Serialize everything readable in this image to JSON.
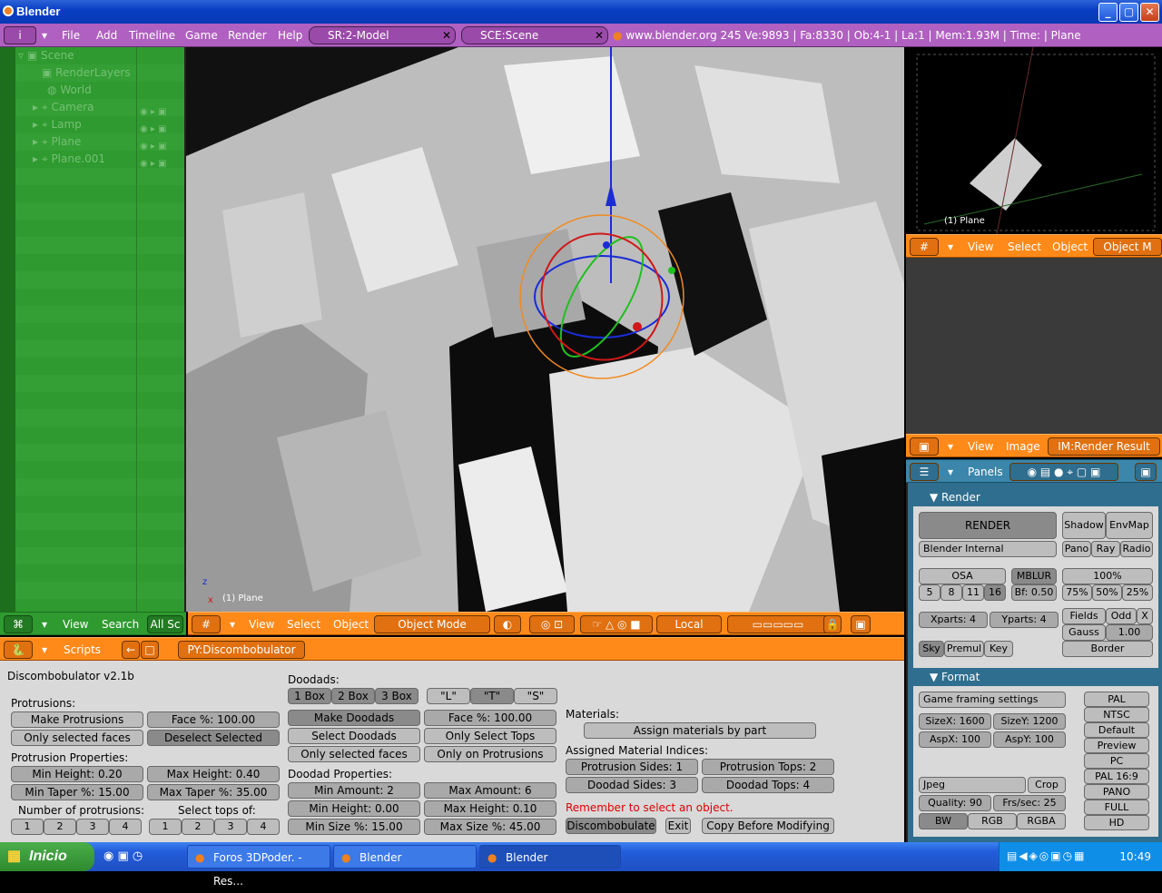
{
  "window": {
    "title": "Blender",
    "min": "_",
    "max": "▢",
    "close": "✕"
  },
  "menubar": {
    "menus": [
      "File",
      "Add",
      "Timeline",
      "Game",
      "Render",
      "Help"
    ],
    "screen": "SR:2-Model",
    "scene": "SCE:Scene",
    "site": "www.blender.org 245",
    "stats": "Ve:9893 | Fa:8330 | Ob:4-1 | La:1 | Mem:1.93M | Time: | Plane"
  },
  "outliner": {
    "items": [
      {
        "label": "Scene",
        "indent": 0
      },
      {
        "label": "RenderLayers",
        "indent": 1
      },
      {
        "label": "World",
        "indent": 1
      },
      {
        "label": "Camera",
        "indent": 1
      },
      {
        "label": "Lamp",
        "indent": 1
      },
      {
        "label": "Plane",
        "indent": 1
      },
      {
        "label": "Plane.001",
        "indent": 1
      }
    ],
    "header": {
      "view": "View",
      "search": "Search",
      "filter": "All Sc"
    }
  },
  "viewport": {
    "label": "(1) Plane",
    "header": {
      "view": "View",
      "select": "Select",
      "object": "Object",
      "mode": "Object Mode",
      "orientation": "Local"
    }
  },
  "preview": {
    "label": "(1) Plane",
    "header": {
      "view": "View",
      "select": "Select",
      "object": "Object",
      "mode": "Object M"
    }
  },
  "imageview": {
    "header": {
      "view": "View",
      "image": "Image",
      "name": "IM:Render Result"
    }
  },
  "buttons": {
    "header": {
      "panels": "Panels"
    },
    "render_panel": {
      "title": "Render",
      "render": "RENDER",
      "engine": "Blender Internal",
      "shadow": "Shadow",
      "envmap": "EnvMap",
      "pano": "Pano",
      "ray": "Ray",
      "radio": "Radio",
      "osa": "OSA",
      "osa_values": [
        "5",
        "8",
        "11",
        "16"
      ],
      "mblur": "MBLUR",
      "bf": "Bf: 0.50",
      "percent": "100%",
      "percents": [
        "75%",
        "50%",
        "25%"
      ],
      "xparts": "Xparts: 4",
      "yparts": "Yparts: 4",
      "fields": "Fields",
      "odd": "Odd",
      "x": "X",
      "gauss": "Gauss",
      "gauss_val": "1.00",
      "sky": "Sky",
      "premul": "Premul",
      "key": "Key",
      "border": "Border"
    },
    "format_panel": {
      "title": "Format",
      "preset": "Game framing settings",
      "sizex": "SizeX: 1600",
      "sizey": "SizeY: 1200",
      "aspx": "AspX: 100",
      "aspy": "AspY: 100",
      "presets": [
        "PAL",
        "NTSC",
        "Default",
        "Preview",
        "PC",
        "PAL 16:9",
        "PANO",
        "FULL",
        "HD"
      ],
      "filetype": "Jpeg",
      "crop": "Crop",
      "quality": "Quality: 90",
      "fps": "Frs/sec: 25",
      "bw": "BW",
      "rgb": "RGB",
      "rgba": "RGBA"
    }
  },
  "scripts": {
    "header": {
      "title": "Scripts",
      "script": "PY:Discombobulator"
    },
    "version": "Discombobulator v2.1b",
    "protrusions": {
      "heading": "Protrusions:",
      "make": "Make Protrusions",
      "face": "Face %: 100.00",
      "only_selected": "Only selected faces",
      "deselect": "Deselect Selected",
      "props_heading": "Protrusion Properties:",
      "min_height": "Min Height: 0.20",
      "max_height": "Max Height: 0.40",
      "min_taper": "Min Taper %: 15.00",
      "max_taper": "Max Taper %: 35.00",
      "number_heading": "Number of protrusions:",
      "tops_heading": "Select tops of:",
      "numbers": [
        "1",
        "2",
        "3",
        "4"
      ],
      "tops": [
        "1",
        "2",
        "3",
        "4"
      ]
    },
    "doodads": {
      "heading": "Doodads:",
      "boxes": [
        "1 Box",
        "2 Box",
        "3 Box"
      ],
      "shapes": [
        "\"L\"",
        "\"T\"",
        "\"S\""
      ],
      "make": "Make Doodads",
      "face": "Face %: 100.00",
      "select": "Select Doodads",
      "only_tops": "Only Select Tops",
      "only_selected": "Only selected faces",
      "only_protrusions": "Only on Protrusions",
      "props_heading": "Doodad Properties:",
      "min_amount": "Min Amount: 2",
      "max_amount": "Max Amount: 6",
      "min_height": "Min Height: 0.00",
      "max_height": "Max Height: 0.10",
      "min_size": "Min Size %: 15.00",
      "max_size": "Max Size %: 45.00"
    },
    "materials": {
      "heading": "Materials:",
      "assign": "Assign materials by part",
      "indices_heading": "Assigned Material Indices:",
      "prot_sides": "Protrusion Sides: 1",
      "prot_tops": "Protrusion Tops: 2",
      "dood_sides": "Doodad Sides: 3",
      "dood_tops": "Doodad Tops: 4",
      "warning": "Remember to select an object.",
      "discombobulate": "Discombobulate",
      "exit": "Exit",
      "copy": "Copy Before Modifying"
    }
  },
  "taskbar": {
    "start": "Inicio",
    "tasks": [
      "Foros 3DPoder. - Res...",
      "Blender",
      "Blender"
    ],
    "clock": "10:49"
  },
  "colors": {
    "accent": "#ff8a1a",
    "menubar": "#b060c0",
    "outliner": "#2f9a2f",
    "buttons": "#2f6e8e"
  }
}
